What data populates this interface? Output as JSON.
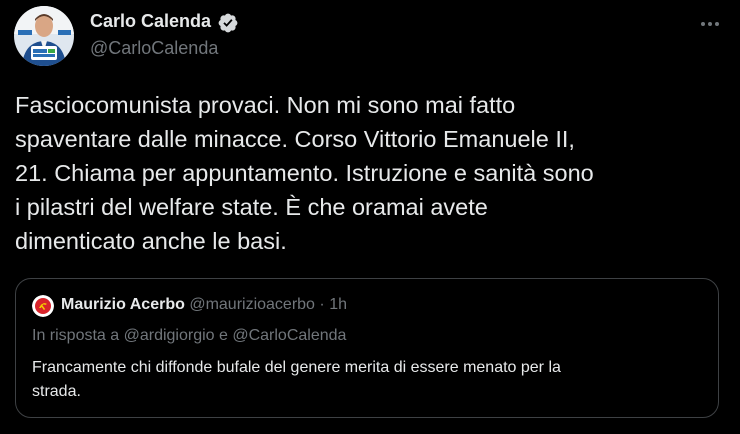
{
  "author": {
    "name": "Carlo Calenda",
    "handle": "@CarloCalenda",
    "avatar_icon": "profile-photo-icon",
    "verified_icon": "verified-badge-icon"
  },
  "more_icon": "more-options-icon",
  "tweet": {
    "lines": [
      "Fasciocomunista provaci. Non mi sono mai fatto",
      "spaventare dalle minacce. Corso Vittorio Emanuele II,",
      "21. Chiama per appuntamento. Istruzione e sanità sono",
      "i pilastri del welfare state. È che oramai avete",
      "dimenticato anche le basi."
    ]
  },
  "quoted": {
    "name": "Maurizio Acerbo",
    "handle": "@maurizioacerbo",
    "separator": "·",
    "time": "1h",
    "avatar_icon": "party-logo-icon",
    "reply_to": "In risposta a @ardigiorgio e @CarloCalenda",
    "lines": [
      "Francamente chi diffonde bufale del genere merita di essere menato per la",
      "strada."
    ]
  },
  "colors": {
    "background": "#000000",
    "text": "#e7e9ea",
    "secondary": "#71767b",
    "border": "#3e4144",
    "verified": "#1d9bf0"
  }
}
